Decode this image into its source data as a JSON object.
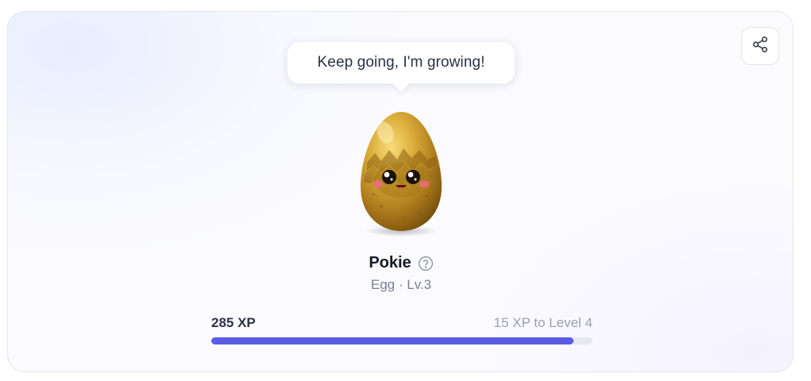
{
  "speech_bubble": {
    "text": "Keep going, I'm growing!"
  },
  "pet": {
    "name": "Pokie",
    "subtitle": "Egg · Lv.3"
  },
  "xp": {
    "current_label": "285 XP",
    "next_label": "15 XP to Level 4",
    "progress_fraction": 0.95
  },
  "icons": {
    "share": "share-icon",
    "help": "help-circle-icon"
  },
  "colors": {
    "progress": "#5b5be6",
    "track": "#e6e8ee",
    "egg_gold": "#c9962a"
  }
}
